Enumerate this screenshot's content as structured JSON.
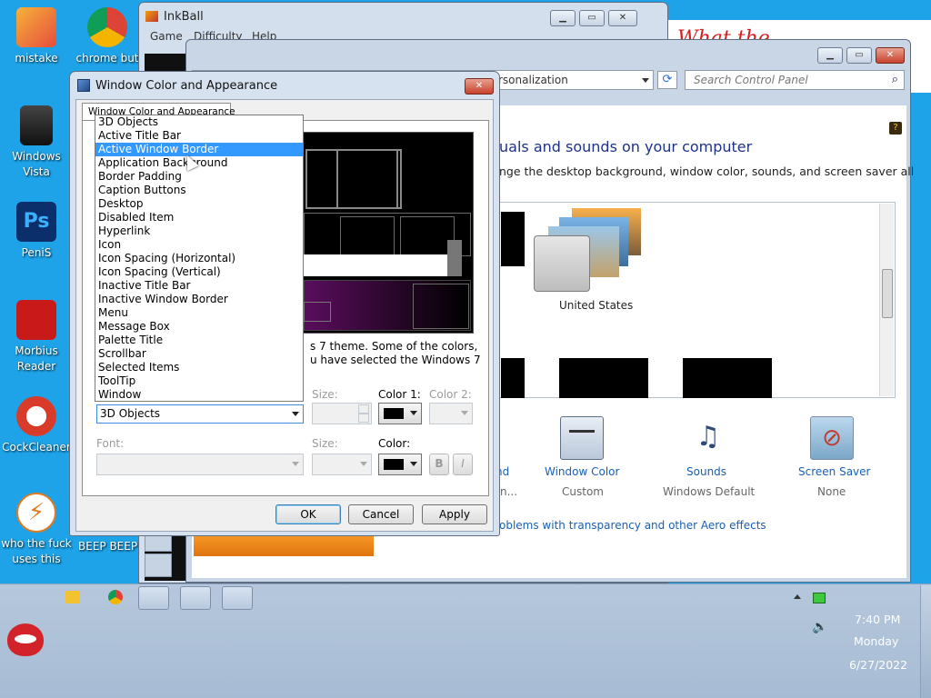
{
  "desktop": {
    "icons": [
      {
        "label": "mistake"
      },
      {
        "label": "chrome but"
      },
      {
        "label": "Windows Vista"
      },
      {
        "label": "PeniS"
      },
      {
        "label": "Morbius Reader"
      },
      {
        "label": "CockCleaner"
      },
      {
        "label": "who the fuck uses this"
      },
      {
        "label": "BEEP BEEP"
      }
    ],
    "scribble_text": "What the ..."
  },
  "inkball": {
    "title": "InkBall",
    "menu": [
      "Game",
      "Difficulty",
      "Help"
    ]
  },
  "control_panel": {
    "address": "rsonalization",
    "search_placeholder": "Search Control Panel",
    "heading": "uals and sounds on your computer",
    "subheading": "nge the desktop background, window color, sounds, and screen saver all",
    "theme_label": "United States",
    "items": [
      {
        "label": "nd",
        "sub": "n..."
      },
      {
        "label": "Window Color",
        "sub": "Custom"
      },
      {
        "label": "Sounds",
        "sub": "Windows Default"
      },
      {
        "label": "Screen Saver",
        "sub": "None"
      }
    ],
    "aero_link": "oblems with transparency and other Aero effects"
  },
  "dialog": {
    "title": "Window Color and Appearance",
    "tab": "Window Color and Appearance",
    "info_text_1": "s 7 theme.  Some of the colors,",
    "info_text_2": "u have selected the Windows 7",
    "item_selected": "3D Objects",
    "labels": {
      "size": "Size:",
      "color1": "Color 1:",
      "color2": "Color 2:",
      "font": "Font:",
      "font_size": "Size:",
      "color": "Color:",
      "bold": "B",
      "italic": "I"
    },
    "buttons": {
      "ok": "OK",
      "cancel": "Cancel",
      "apply": "Apply"
    },
    "dropdown_items": [
      "3D Objects",
      "Active Title Bar",
      "Active Window Border",
      "Application Background",
      "Border Padding",
      "Caption Buttons",
      "Desktop",
      "Disabled Item",
      "Hyperlink",
      "Icon",
      "Icon Spacing (Horizontal)",
      "Icon Spacing (Vertical)",
      "Inactive Title Bar",
      "Inactive Window Border",
      "Menu",
      "Message Box",
      "Palette Title",
      "Scrollbar",
      "Selected Items",
      "ToolTip",
      "Window"
    ],
    "dropdown_selected_index": 2
  },
  "taskbar": {
    "time": "7:40 PM",
    "day": "Monday",
    "date": "6/27/2022"
  },
  "colors": {
    "accent": "#3399ff",
    "desktop": "#1ea3e8"
  }
}
